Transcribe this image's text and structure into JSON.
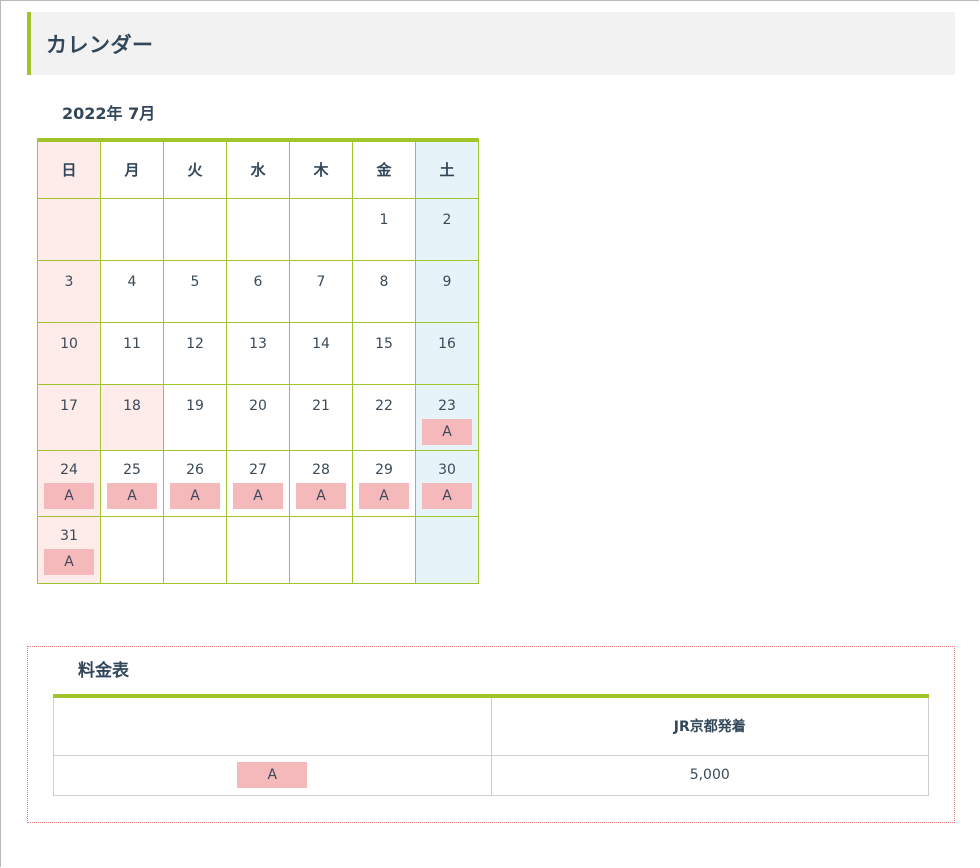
{
  "page": {
    "heading": "カレンダー"
  },
  "calendar": {
    "title": "2022年 7月",
    "weekdays": [
      "日",
      "月",
      "火",
      "水",
      "木",
      "金",
      "土"
    ],
    "weeks": [
      [
        {
          "day": ""
        },
        {
          "day": ""
        },
        {
          "day": ""
        },
        {
          "day": ""
        },
        {
          "day": ""
        },
        {
          "day": "1"
        },
        {
          "day": "2"
        }
      ],
      [
        {
          "day": "3"
        },
        {
          "day": "4"
        },
        {
          "day": "5"
        },
        {
          "day": "6"
        },
        {
          "day": "7"
        },
        {
          "day": "8"
        },
        {
          "day": "9"
        }
      ],
      [
        {
          "day": "10"
        },
        {
          "day": "11"
        },
        {
          "day": "12"
        },
        {
          "day": "13"
        },
        {
          "day": "14"
        },
        {
          "day": "15"
        },
        {
          "day": "16"
        }
      ],
      [
        {
          "day": "17"
        },
        {
          "day": "18",
          "holiday": true
        },
        {
          "day": "19"
        },
        {
          "day": "20"
        },
        {
          "day": "21"
        },
        {
          "day": "22"
        },
        {
          "day": "23",
          "badge": "A"
        }
      ],
      [
        {
          "day": "24",
          "badge": "A"
        },
        {
          "day": "25",
          "badge": "A"
        },
        {
          "day": "26",
          "badge": "A"
        },
        {
          "day": "27",
          "badge": "A"
        },
        {
          "day": "28",
          "badge": "A"
        },
        {
          "day": "29",
          "badge": "A"
        },
        {
          "day": "30",
          "badge": "A"
        }
      ],
      [
        {
          "day": "31",
          "badge": "A"
        },
        {
          "day": ""
        },
        {
          "day": ""
        },
        {
          "day": ""
        },
        {
          "day": ""
        },
        {
          "day": ""
        },
        {
          "day": ""
        }
      ]
    ]
  },
  "fees": {
    "title": "料金表",
    "headers": [
      "",
      "JR京都発着"
    ],
    "rows": [
      {
        "plan": "A",
        "price": "5,000"
      }
    ]
  },
  "colors": {
    "accent": "#a0c42a",
    "sunday_bg": "#fdecea",
    "saturday_bg": "#e6f4f9",
    "badge_bg": "#f5b8bb",
    "heading_bg": "#f2f2f2"
  }
}
